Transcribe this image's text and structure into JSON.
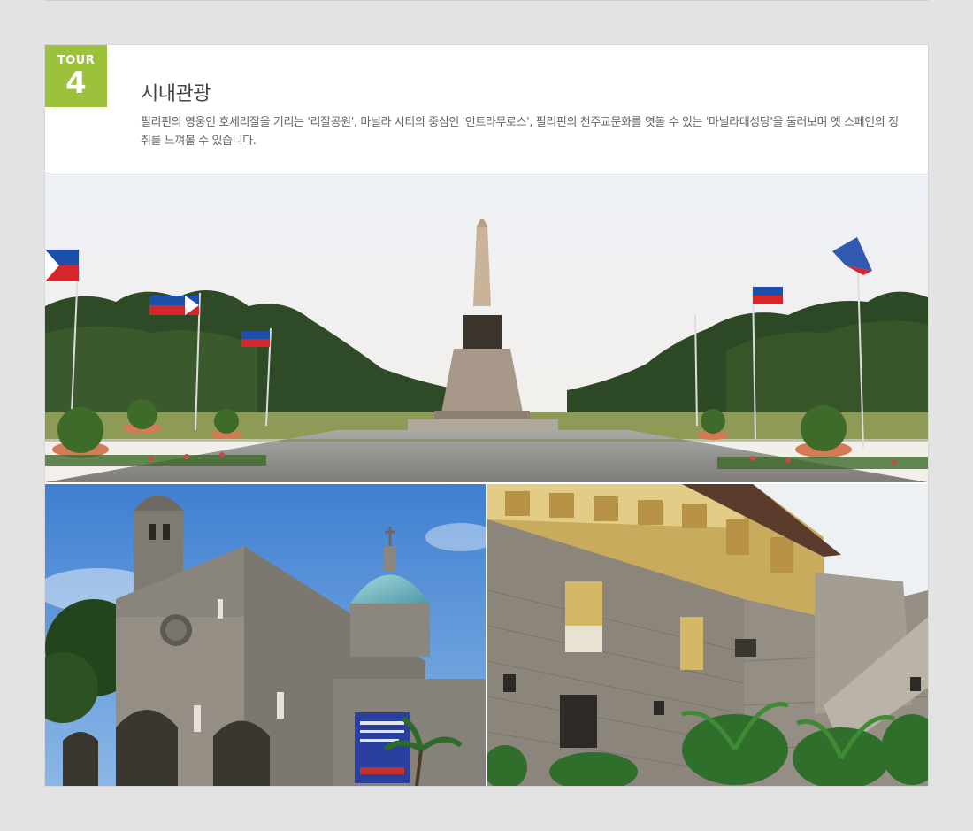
{
  "tour": {
    "badge_label": "TOUR",
    "badge_number": "4",
    "badge_color": "#9bc23a",
    "title": "시내관광",
    "description": "필리핀의 영웅인 호세리잘을 기리는 '리잘공원', 마닐라 시티의 중심인 '인트라무로스', 필리핀의 천주교문화를 엿볼 수 있는 '마닐라대성당'을 둘러보며 옛 스페인의 정취를 느껴볼 수 있습니다."
  },
  "photos": [
    {
      "name": "rizal-park-monument-photo"
    },
    {
      "name": "manila-cathedral-photo"
    },
    {
      "name": "intramuros-stone-house-photo"
    }
  ]
}
